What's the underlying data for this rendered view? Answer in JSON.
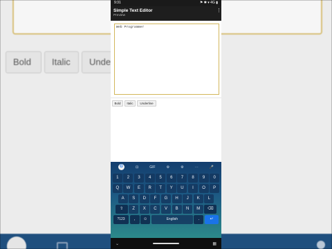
{
  "background": {
    "buttons": [
      "Bold",
      "Italic",
      "Unde"
    ]
  },
  "status": {
    "time": "9:31",
    "icons": "⚑ ✱ ▾ 4G ▮"
  },
  "app": {
    "title": "Simple Text Editor",
    "subtitle": "Preview"
  },
  "editor": {
    "value": "Web Programmer"
  },
  "toolbar": {
    "bold_label": "Bold",
    "italic_label": "Italic",
    "underline_label": "Underline"
  },
  "keyboard": {
    "top_items": [
      "G",
      "⊡",
      "GIF",
      "⚙",
      "⚙",
      "⋯",
      "🎤"
    ],
    "row1": [
      "1",
      "2",
      "3",
      "4",
      "5",
      "6",
      "7",
      "8",
      "9",
      "0"
    ],
    "row2": [
      "Q",
      "W",
      "E",
      "R",
      "T",
      "Y",
      "U",
      "I",
      "O",
      "P"
    ],
    "row3": [
      "A",
      "S",
      "D",
      "F",
      "G",
      "H",
      "J",
      "K",
      "L"
    ],
    "row4": [
      "⇧",
      "Z",
      "X",
      "C",
      "V",
      "B",
      "N",
      "M",
      "⌫"
    ],
    "row5": {
      "symbols": "?123",
      "comma": ",",
      "emoji": "☺",
      "space": "English",
      "period": ".",
      "enter": "↵"
    }
  },
  "nav": {
    "back": "⌄",
    "home": "",
    "recents": "▦"
  }
}
